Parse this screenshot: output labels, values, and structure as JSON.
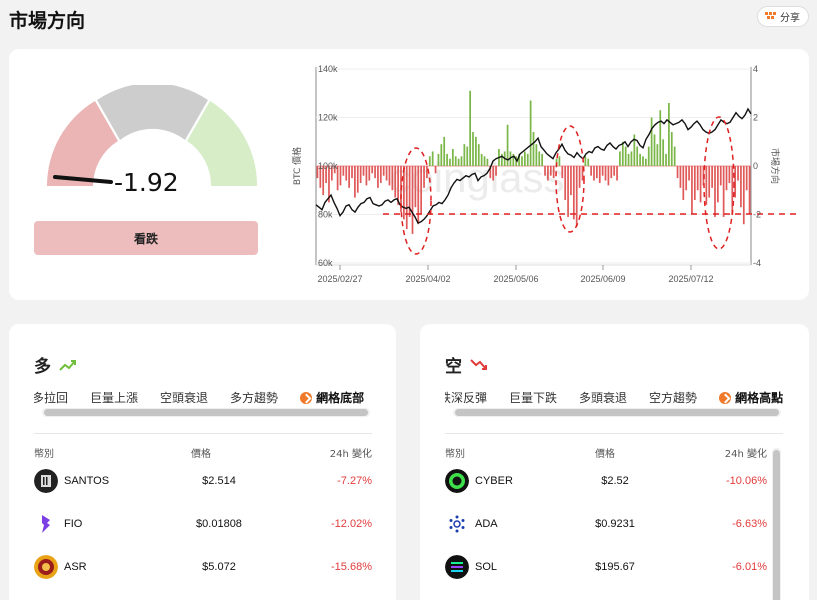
{
  "header": {
    "title": "市場方向",
    "share_label": "分享",
    "share_icon": "share-icon"
  },
  "gauge": {
    "value": "-1.92",
    "button_label": "看跌"
  },
  "chart_data": {
    "type": "bar+line",
    "watermark": "coinglass",
    "yleft_label": "BTC 價格",
    "yright_label": "市場方向",
    "yleft_ticks": [
      "140k",
      "120k",
      "100k",
      "80k",
      "60k"
    ],
    "yright_ticks": [
      "4",
      "2",
      "0",
      "-2",
      "-4"
    ],
    "yleft_range": [
      60000,
      140000
    ],
    "yright_range": [
      -4,
      4
    ],
    "x_ticks": [
      "2025/02/27",
      "2025/04/02",
      "2025/05/06",
      "2025/06/09",
      "2025/07/12"
    ],
    "direction_values": [
      -0.5,
      -0.9,
      -1.2,
      -0.7,
      -1.5,
      -0.6,
      -0.3,
      -1.0,
      -0.8,
      -0.4,
      -0.6,
      -0.9,
      -0.5,
      -1.3,
      -1.1,
      -0.7,
      -0.4,
      -0.8,
      -0.6,
      -0.3,
      -0.5,
      -0.9,
      -0.7,
      -0.4,
      -0.6,
      -0.8,
      -1.0,
      -1.3,
      -1.6,
      -1.9,
      -2.2,
      -2.6,
      -2.1,
      -2.8,
      -1.7,
      -2.4,
      -2.0,
      -0.9,
      -0.5,
      0.4,
      0.6,
      -0.3,
      0.5,
      0.9,
      1.2,
      0.5,
      0.3,
      0.7,
      0.4,
      0.3,
      0.4,
      0.9,
      0.8,
      3.1,
      1.4,
      1.2,
      0.9,
      0.5,
      0.4,
      0.3,
      -0.5,
      -0.6,
      -0.4,
      0.7,
      0.5,
      0.6,
      1.7,
      0.6,
      0.5,
      0.4,
      0.5,
      0.4,
      0.6,
      0.5,
      2.7,
      1.4,
      0.9,
      0.6,
      0.5,
      -0.4,
      -0.6,
      -0.4,
      -0.5,
      0.3,
      0.4,
      -0.5,
      -1.4,
      -2.1,
      -1.2,
      -2.2,
      -2.5,
      -0.9,
      -0.6,
      0.4,
      0.3,
      -0.4,
      -0.6,
      -0.5,
      -0.7,
      -0.4,
      -0.6,
      -0.8,
      -0.5,
      -0.4,
      -0.6,
      0.6,
      1.0,
      0.8,
      0.5,
      0.6,
      1.3,
      0.8,
      0.5,
      0.4,
      0.3,
      0.8,
      2.0,
      1.3,
      0.9,
      2.3,
      1.1,
      0.5,
      2.6,
      1.4,
      0.8,
      -0.5,
      -0.9,
      -1.4,
      -1.0,
      -0.6,
      -2.0,
      -1.4,
      -1.0,
      -1.5,
      -0.8,
      -1.6,
      -1.3,
      -0.9,
      -2.1,
      -1.5,
      -0.8,
      -2.1,
      -1.0,
      -0.7,
      -2.0,
      -1.3,
      -0.6,
      -1.7,
      -2.4,
      -1.0,
      -2.0
    ],
    "price_values": [
      84000,
      83000,
      82000,
      85000,
      86500,
      88000,
      85000,
      82500,
      79500,
      81000,
      83500,
      84000,
      82000,
      81000,
      83000,
      84500,
      85000,
      86500,
      87000,
      84500,
      84000,
      83500,
      84000,
      85500,
      86000,
      85000,
      86000,
      86500,
      84000,
      83000,
      82500,
      83000,
      81000,
      79000,
      76500,
      77000,
      78000,
      79500,
      81500,
      83500,
      84000,
      85000,
      84500,
      86000,
      88000,
      91000,
      93000,
      94500,
      94000,
      95000,
      96000,
      95500,
      96500,
      97000,
      94000,
      95500,
      96000,
      97000,
      99000,
      102000,
      103000,
      103500,
      104000,
      103000,
      102500,
      103500,
      104000,
      102000,
      105000,
      106000,
      107000,
      108000,
      109000,
      110000,
      111500,
      108000,
      106500,
      105000,
      104000,
      103000,
      105500,
      107000,
      109000,
      106500,
      105000,
      104500,
      103500,
      105500,
      104000,
      103000,
      105000,
      106000,
      105500,
      107500,
      108000,
      107000,
      106500,
      108500,
      109500,
      108000,
      107000,
      108500,
      109000,
      110000,
      108000,
      110000,
      111000,
      110500,
      108500,
      107500,
      111000,
      113000,
      115500,
      117000,
      118000,
      118500,
      117500,
      119000,
      118000,
      117000,
      117500,
      118000,
      119000,
      117500,
      115000,
      116000,
      117500,
      118500,
      117000,
      115000,
      114000,
      113500,
      114000,
      115000,
      117000,
      119000,
      118000,
      117500,
      118000,
      120000,
      122000,
      120500,
      119500,
      121000,
      123500,
      121500
    ],
    "reference_line": -2
  },
  "long": {
    "title": "多",
    "tabs": [
      "縮多拉回",
      "巨量上漲",
      "空頭衰退",
      "多方趨勢",
      "網格底部"
    ],
    "columns": [
      "幣別",
      "價格",
      "24h 變化"
    ],
    "rows": [
      {
        "coin": "SANTOS",
        "price": "$2.514",
        "change": "-7.27%"
      },
      {
        "coin": "FIO",
        "price": "$0.01808",
        "change": "-12.02%"
      },
      {
        "coin": "ASR",
        "price": "$5.072",
        "change": "-15.68%"
      }
    ]
  },
  "short": {
    "title": "空",
    "tabs": [
      "跌深反彈",
      "巨量下跌",
      "多頭衰退",
      "空方趨勢",
      "網格高點"
    ],
    "columns": [
      "幣別",
      "價格",
      "24h 變化"
    ],
    "rows": [
      {
        "coin": "CYBER",
        "price": "$2.52",
        "change": "-10.06%"
      },
      {
        "coin": "ADA",
        "price": "$0.9231",
        "change": "-6.63%"
      },
      {
        "coin": "SOL",
        "price": "$195.67",
        "change": "-6.01%"
      }
    ]
  },
  "colors": {
    "up": "#7ab648",
    "down": "#e05a5a",
    "bear_button": "#edbcbc",
    "accent": "#f07a2a"
  }
}
